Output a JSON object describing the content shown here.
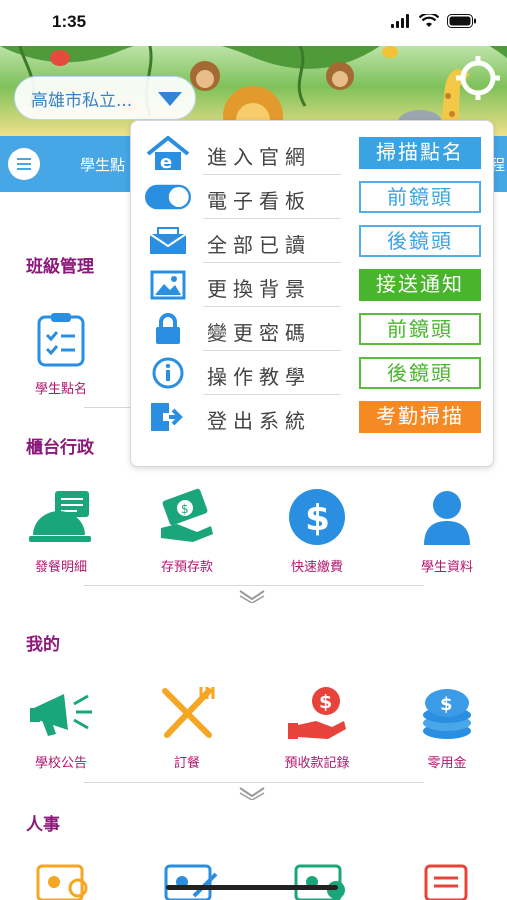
{
  "status_bar": {
    "time": "1:35"
  },
  "banner": {
    "school_name": "高雄市私立..."
  },
  "nav": {
    "items": [
      "學生點",
      "程"
    ]
  },
  "sections": [
    {
      "title": "班級管理",
      "items": [
        {
          "label": "學生點名",
          "icon": "clipboard-icon"
        }
      ]
    },
    {
      "title": "櫃台行政",
      "items": [
        {
          "label": "發餐明細",
          "icon": "cloche-icon"
        },
        {
          "label": "存預存款",
          "icon": "money-deposit-icon"
        },
        {
          "label": "快速繳費",
          "icon": "dollar-icon"
        },
        {
          "label": "學生資料",
          "icon": "student-icon"
        }
      ]
    },
    {
      "title": "我的",
      "items": [
        {
          "label": "學校公告",
          "icon": "megaphone-icon"
        },
        {
          "label": "訂餐",
          "icon": "utensils-icon"
        },
        {
          "label": "預收款記錄",
          "icon": "hand-money-icon"
        },
        {
          "label": "零用金",
          "icon": "coins-icon"
        }
      ]
    },
    {
      "title": "人事",
      "items": []
    }
  ],
  "popup_menu": {
    "items": [
      {
        "label": "進入官網",
        "icon": "home-web-icon"
      },
      {
        "label": "電子看板",
        "icon": "toggle-switch",
        "toggle_on": true
      },
      {
        "label": "全部已讀",
        "icon": "envelope-icon"
      },
      {
        "label": "更換背景",
        "icon": "image-icon"
      },
      {
        "label": "變更密碼",
        "icon": "lock-icon"
      },
      {
        "label": "操作教學",
        "icon": "info-icon"
      },
      {
        "label": "登出系統",
        "icon": "logout-icon"
      }
    ],
    "actions": [
      {
        "label": "掃描點名",
        "style": "solid-blue"
      },
      {
        "label": "前鏡頭",
        "style": "outline-blue"
      },
      {
        "label": "後鏡頭",
        "style": "outline-blue"
      },
      {
        "label": "接送通知",
        "style": "solid-green"
      },
      {
        "label": "前鏡頭",
        "style": "outline-green"
      },
      {
        "label": "後鏡頭",
        "style": "outline-green"
      },
      {
        "label": "考勤掃描",
        "style": "solid-orange"
      }
    ]
  },
  "colors": {
    "nav_blue": "#46a6e6",
    "section_title": "#8b1a7a",
    "item_label": "#b0176f",
    "icon_teal": "#1aa57a",
    "icon_blue": "#2a8fe0"
  }
}
